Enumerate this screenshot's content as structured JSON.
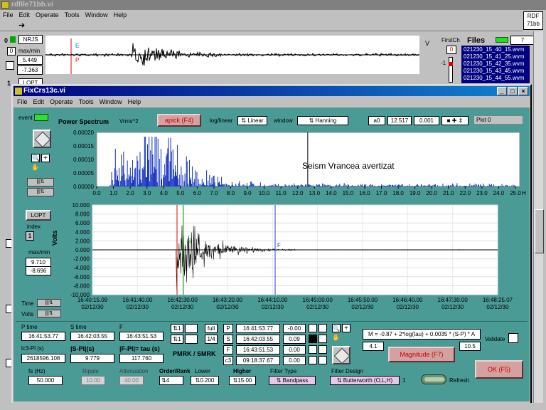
{
  "main_window": {
    "title": "rdfile71bb.vi",
    "menu": [
      "File",
      "Edit",
      "Operate",
      "Tools",
      "Window",
      "Help"
    ],
    "rdf_badge": [
      "RDF",
      "71bb"
    ],
    "channel_top": {
      "index": "0",
      "name": "NRJS",
      "maxmin_label": "max/min",
      "max": "5.449",
      "min": "-7.363",
      "e_mark": "E",
      "p_mark": "P"
    },
    "channel_second": {
      "index": "1",
      "name": "LOPT"
    },
    "unit_label": "V",
    "firstch_label": "FirstCh",
    "firstch_value": "0",
    "firstch_minus": "-1",
    "files_label": "Files",
    "files_count": "7",
    "files": [
      "021230_15_40_15.wvm",
      "021230_15_41_25.wvm",
      "021230_15_42_35.wvm",
      "021230_15_43_45.wvm",
      "021230_15_44_55.wvm"
    ]
  },
  "sub_window": {
    "title": "FixCrs13c.vi",
    "menu": [
      "File",
      "Edit",
      "Operate",
      "Tools",
      "Window",
      "Help"
    ],
    "event_label": "event",
    "spectrum_title": "Power Spectrum",
    "spectrum_unit": "Vrms^2",
    "apick_label": "apick (F4)",
    "loglinear_label": "log/linear",
    "loglinear_value": "Linear",
    "window_label": "window",
    "window_value": "Hanning",
    "a0_label": "a0",
    "a0_value": "12.517",
    "a0_small": "0.001",
    "plot_label": "Plot 0",
    "annotation": "Seism Vrancea avertizat",
    "channel_name": "LOPT",
    "index_label": "index",
    "index_value": "1",
    "maxmin_label": "max/min",
    "max_value": "9.710",
    "min_value": "-8.696",
    "volts_axis": "Volts",
    "time_label": "Time",
    "volts_label": "Volts",
    "spec_yticks": [
      "0.00020",
      "0.00015",
      "0.00010",
      "0.00005",
      "0.00000"
    ],
    "spec_xticks": [
      "0.0",
      "1.0",
      "2.0",
      "3.0",
      "4.0",
      "5.0",
      "6.0",
      "7.0",
      "8.0",
      "9.0",
      "10.0",
      "11.0",
      "12.0",
      "13.0",
      "14.0",
      "15.0",
      "16.0",
      "17.0",
      "18.0",
      "19.0",
      "20.0",
      "21.0",
      "22.0",
      "23.0",
      "24.0",
      "25.0"
    ],
    "spec_xunit": "Hz",
    "wave_yticks": [
      "10.000",
      "8.000",
      "6.000",
      "4.000",
      "2.000",
      "0.000",
      "-2.000",
      "-4.000",
      "-6.000",
      "-8.000",
      "-10.000"
    ],
    "wave_xticks": [
      [
        "16:40:15.09",
        "02/12/30"
      ],
      [
        "16:41:40.00",
        "02/12/30"
      ],
      [
        "16:42:30.00",
        "02/12/30"
      ],
      [
        "16:43:20.00",
        "02/12/30"
      ],
      [
        "16:44:10.00",
        "02/12/30"
      ],
      [
        "16:45:00.00",
        "02/12/30"
      ],
      [
        "16:45:50.00",
        "02/12/30"
      ],
      [
        "16:46:40.00",
        "02/12/30"
      ],
      [
        "16:47:30.00",
        "02/12/30"
      ],
      [
        "16:48:25.07",
        "02/12/30"
      ]
    ],
    "wave_marks": {
      "s": "S",
      "f": "F"
    },
    "ptime_label": "P time",
    "ptime_value": "16:41:53.77",
    "stime_label": "S time",
    "stime_value": "16:42:03.55",
    "f_label": "F",
    "f_value": "16:43:51.53",
    "lc3_label": "lc3-Pl (s)",
    "lc3_value": "2618596.108",
    "sp_label": "|S-Pl|(s)",
    "sp_value": "9.779",
    "fp_label": "|F-Pl|= tau (s)",
    "fp_value": "117.760",
    "full_label": "full",
    "quarter_label": "1/4",
    "one1": "1",
    "one2": "1",
    "pmrk_label": "PMRK / SMRK",
    "mark_rows": [
      {
        "tag": "P",
        "time": "16:41:53.77",
        "val": "-0.00"
      },
      {
        "tag": "S",
        "time": "16:42:03.55",
        "val": "0.09"
      },
      {
        "tag": "F",
        "time": "16:43:51.53",
        "val": "0.00"
      },
      {
        "tag": "c3",
        "time": "09:18:37.67",
        "val": "0.00"
      }
    ],
    "formula": "M = -0.87 + 2*log(tau) + 0.0035 * (S-P) * A",
    "m_left": "4.1",
    "m_right": "10.5",
    "validate_label": "Validate",
    "magnitude_label": "Magnitude (F7)",
    "ok_label": "OK (F5)",
    "refresh_label": "Refresh",
    "fs_label": "fs (Hz)",
    "fs_value": "50.000",
    "ripple_label": "Ripple",
    "ripple_value": "10.00",
    "atten_label": "Attenuation",
    "atten_value": "40.00",
    "order_label": "Order/Rank",
    "order_value": "4",
    "lower_label": "Lower",
    "lower_value": "0.200",
    "higher_label": "Higher",
    "higher_value": "15.00",
    "ftype_label": "Filter Type",
    "ftype_value": "Bandpass",
    "fdesign_label": "Filter Design",
    "fdesign_value": "Butterworth (O,L,H)",
    "fdesign_num": "1"
  },
  "colors": {
    "teal": "#4a9a96",
    "spectrum": "#1030c0",
    "title_active": "#000080",
    "red_button": "#cc0000"
  }
}
